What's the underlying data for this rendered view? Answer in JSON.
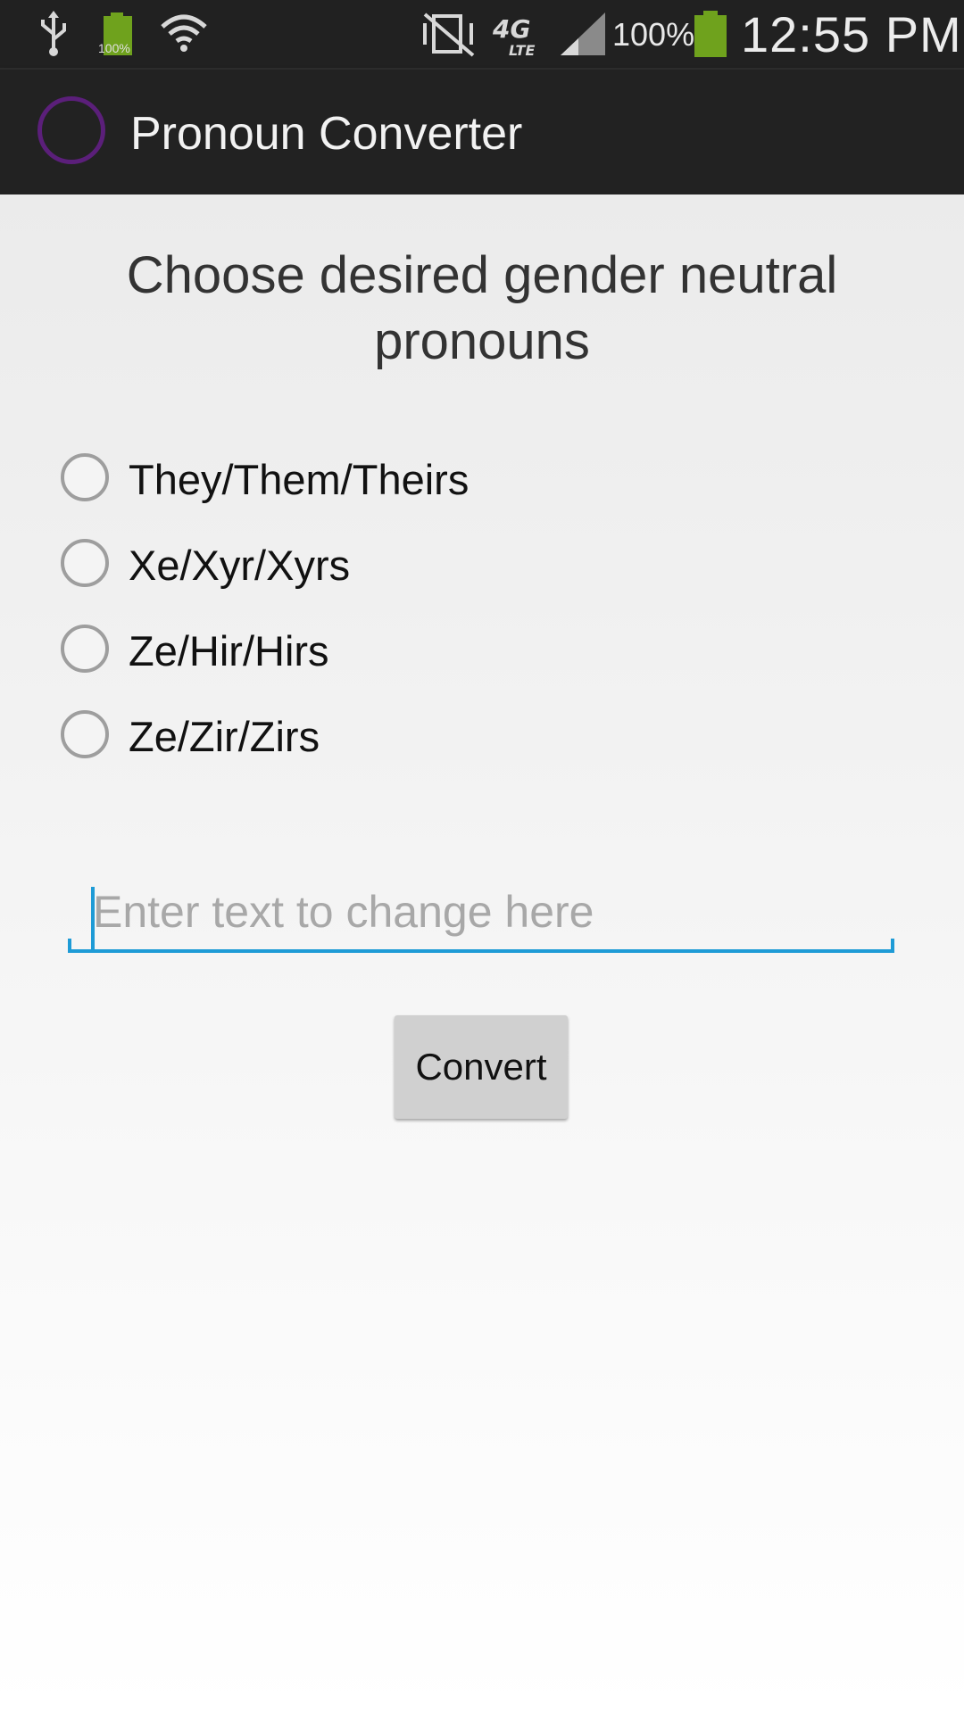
{
  "status_bar": {
    "battery_small_label": "100%",
    "battery_percent": "100%",
    "network_type": "4G LTE",
    "time": "12:55 PM",
    "icons": [
      "usb-icon",
      "battery-icon",
      "wifi-icon",
      "mute-vibrate-icon",
      "4g-lte-icon",
      "signal-icon",
      "battery-icon"
    ],
    "battery_color": "#6fa21d"
  },
  "action_bar": {
    "title": "Pronoun Converter",
    "icon_color": "#5b1f7a"
  },
  "main": {
    "heading": "Choose desired gender neutral pronouns",
    "pronoun_options": [
      {
        "label": "They/Them/Theirs",
        "selected": false
      },
      {
        "label": "Xe/Xyr/Xyrs",
        "selected": false
      },
      {
        "label": "Ze/Hir/Hirs",
        "selected": false
      },
      {
        "label": "Ze/Zir/Zirs",
        "selected": false
      }
    ],
    "text_input": {
      "value": "",
      "placeholder": "Enter text to change here"
    },
    "convert_button": "Convert",
    "accent_color": "#1e9bd6"
  }
}
